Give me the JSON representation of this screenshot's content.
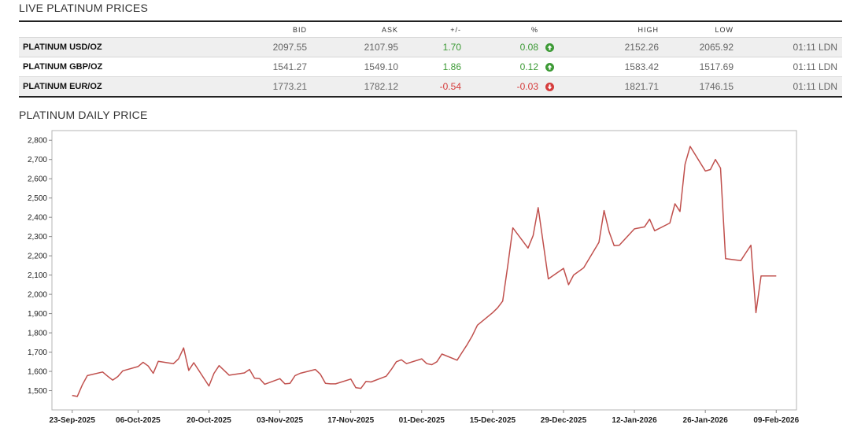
{
  "table": {
    "title": "LIVE PLATINUM PRICES",
    "headers": {
      "bid": "BID",
      "ask": "ASK",
      "change": "+/-",
      "pct": "%",
      "high": "HIGH",
      "low": "LOW"
    },
    "rows": [
      {
        "name": "PLATINUM USD/OZ",
        "bid": "2097.55",
        "ask": "2107.95",
        "change": "1.70",
        "pct": "0.08",
        "dir": "up",
        "high": "2152.26",
        "low": "2065.92",
        "time": "01:11 LDN"
      },
      {
        "name": "PLATINUM GBP/OZ",
        "bid": "1541.27",
        "ask": "1549.10",
        "change": "1.86",
        "pct": "0.12",
        "dir": "up",
        "high": "1583.42",
        "low": "1517.69",
        "time": "01:11 LDN"
      },
      {
        "name": "PLATINUM EUR/OZ",
        "bid": "1773.21",
        "ask": "1782.12",
        "change": "-0.54",
        "pct": "-0.03",
        "dir": "down",
        "high": "1821.71",
        "low": "1746.15",
        "time": "01:11 LDN"
      }
    ]
  },
  "colors": {
    "line": "#c0504d",
    "up": "#3d9a36",
    "down": "#d53b3b",
    "frame": "#b5b5b5"
  },
  "chart_data": {
    "type": "line",
    "title": "PLATINUM DAILY PRICE",
    "xlabel": "",
    "ylabel": "",
    "grid": false,
    "ylim": [
      1400,
      2850
    ],
    "yticks": [
      1500,
      1600,
      1700,
      1800,
      1900,
      2000,
      2100,
      2200,
      2300,
      2400,
      2500,
      2600,
      2700,
      2800
    ],
    "ytick_labels": [
      "1,500",
      "1,600",
      "1,700",
      "1,800",
      "1,900",
      "2,000",
      "2,100",
      "2,200",
      "2,300",
      "2,400",
      "2,500",
      "2,600",
      "2,700",
      "2,800"
    ],
    "xlim": [
      "2025-09-19",
      "2026-02-13"
    ],
    "xticks": [
      "2025-09-23",
      "2025-10-06",
      "2025-10-20",
      "2025-11-03",
      "2025-11-17",
      "2025-12-01",
      "2025-12-15",
      "2025-12-29",
      "2026-01-12",
      "2026-01-26",
      "2026-02-09"
    ],
    "xtick_labels": [
      "23-Sep-2025",
      "06-Oct-2025",
      "20-Oct-2025",
      "03-Nov-2025",
      "17-Nov-2025",
      "01-Dec-2025",
      "15-Dec-2025",
      "29-Dec-2025",
      "12-Jan-2026",
      "26-Jan-2026",
      "09-Feb-2026"
    ],
    "series": [
      {
        "points": [
          [
            "2025-09-23",
            1475
          ],
          [
            "2025-09-24",
            1470
          ],
          [
            "2025-09-25",
            1530
          ],
          [
            "2025-09-26",
            1578
          ],
          [
            "2025-09-29",
            1597
          ],
          [
            "2025-09-30",
            1575
          ],
          [
            "2025-10-01",
            1555
          ],
          [
            "2025-10-02",
            1573
          ],
          [
            "2025-10-03",
            1603
          ],
          [
            "2025-10-06",
            1625
          ],
          [
            "2025-10-07",
            1647
          ],
          [
            "2025-10-08",
            1628
          ],
          [
            "2025-10-09",
            1590
          ],
          [
            "2025-10-10",
            1652
          ],
          [
            "2025-10-13",
            1640
          ],
          [
            "2025-10-14",
            1665
          ],
          [
            "2025-10-15",
            1722
          ],
          [
            "2025-10-16",
            1605
          ],
          [
            "2025-10-17",
            1645
          ],
          [
            "2025-10-20",
            1524
          ],
          [
            "2025-10-21",
            1590
          ],
          [
            "2025-10-22",
            1630
          ],
          [
            "2025-10-23",
            1605
          ],
          [
            "2025-10-24",
            1580
          ],
          [
            "2025-10-27",
            1592
          ],
          [
            "2025-10-28",
            1610
          ],
          [
            "2025-10-29",
            1565
          ],
          [
            "2025-10-30",
            1562
          ],
          [
            "2025-10-31",
            1533
          ],
          [
            "2025-11-03",
            1562
          ],
          [
            "2025-11-04",
            1535
          ],
          [
            "2025-11-05",
            1538
          ],
          [
            "2025-11-06",
            1578
          ],
          [
            "2025-11-07",
            1590
          ],
          [
            "2025-11-10",
            1610
          ],
          [
            "2025-11-11",
            1585
          ],
          [
            "2025-11-12",
            1538
          ],
          [
            "2025-11-13",
            1535
          ],
          [
            "2025-11-14",
            1535
          ],
          [
            "2025-11-17",
            1560
          ],
          [
            "2025-11-18",
            1515
          ],
          [
            "2025-11-19",
            1512
          ],
          [
            "2025-11-20",
            1548
          ],
          [
            "2025-11-21",
            1545
          ],
          [
            "2025-11-24",
            1575
          ],
          [
            "2025-11-25",
            1610
          ],
          [
            "2025-11-26",
            1650
          ],
          [
            "2025-11-27",
            1660
          ],
          [
            "2025-11-28",
            1640
          ],
          [
            "2025-12-01",
            1665
          ],
          [
            "2025-12-02",
            1640
          ],
          [
            "2025-12-03",
            1635
          ],
          [
            "2025-12-04",
            1650
          ],
          [
            "2025-12-05",
            1690
          ],
          [
            "2025-12-08",
            1658
          ],
          [
            "2025-12-09",
            1700
          ],
          [
            "2025-12-10",
            1740
          ],
          [
            "2025-12-11",
            1785
          ],
          [
            "2025-12-12",
            1840
          ],
          [
            "2025-12-15",
            1905
          ],
          [
            "2025-12-16",
            1930
          ],
          [
            "2025-12-17",
            1965
          ],
          [
            "2025-12-18",
            2150
          ],
          [
            "2025-12-19",
            2345
          ],
          [
            "2025-12-22",
            2240
          ],
          [
            "2025-12-23",
            2305
          ],
          [
            "2025-12-24",
            2450
          ],
          [
            "2025-12-26",
            2080
          ],
          [
            "2025-12-29",
            2135
          ],
          [
            "2025-12-30",
            2050
          ],
          [
            "2025-12-31",
            2100
          ],
          [
            "2026-01-02",
            2138
          ],
          [
            "2026-01-05",
            2270
          ],
          [
            "2026-01-06",
            2435
          ],
          [
            "2026-01-07",
            2325
          ],
          [
            "2026-01-08",
            2253
          ],
          [
            "2026-01-09",
            2255
          ],
          [
            "2026-01-12",
            2340
          ],
          [
            "2026-01-13",
            2345
          ],
          [
            "2026-01-14",
            2350
          ],
          [
            "2026-01-15",
            2390
          ],
          [
            "2026-01-16",
            2330
          ],
          [
            "2026-01-19",
            2370
          ],
          [
            "2026-01-20",
            2470
          ],
          [
            "2026-01-21",
            2430
          ],
          [
            "2026-01-22",
            2675
          ],
          [
            "2026-01-23",
            2768
          ],
          [
            "2026-01-26",
            2640
          ],
          [
            "2026-01-27",
            2648
          ],
          [
            "2026-01-28",
            2700
          ],
          [
            "2026-01-29",
            2655
          ],
          [
            "2026-01-30",
            2185
          ],
          [
            "2026-02-02",
            2175
          ],
          [
            "2026-02-03",
            2215
          ],
          [
            "2026-02-04",
            2255
          ],
          [
            "2026-02-05",
            1905
          ],
          [
            "2026-02-06",
            2095
          ],
          [
            "2026-02-09",
            2095
          ]
        ]
      }
    ]
  }
}
